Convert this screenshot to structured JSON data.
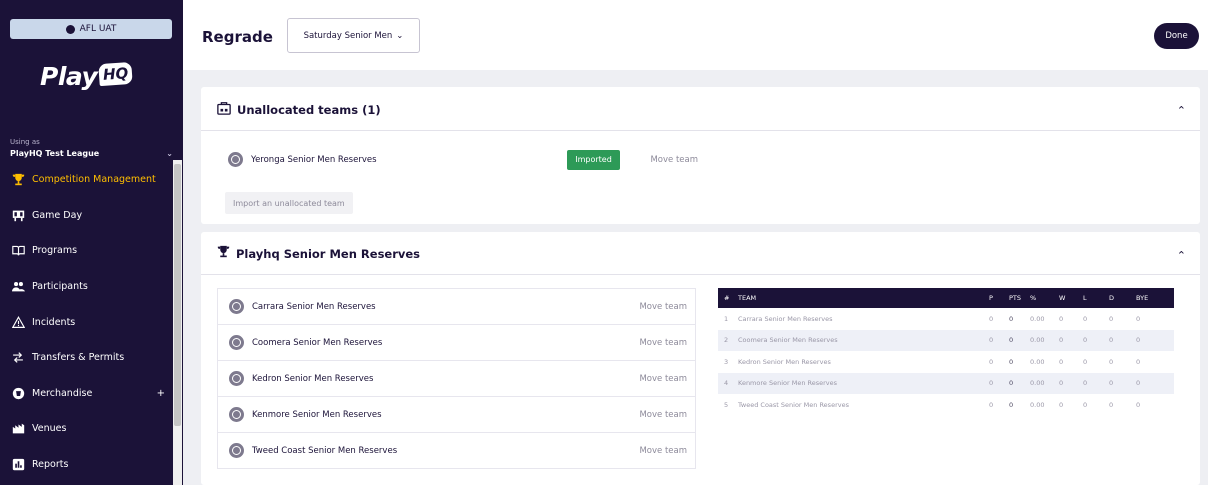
{
  "sidebar": {
    "env": "AFL UAT",
    "logo_play": "Play",
    "logo_hq": "HQ",
    "using_as": "Using as",
    "org_name": "PlayHQ Test League",
    "items": [
      {
        "label": "Competition Management",
        "icon": "trophy-icon",
        "active": true
      },
      {
        "label": "Game Day",
        "icon": "scoreboard-icon"
      },
      {
        "label": "Programs",
        "icon": "book-icon"
      },
      {
        "label": "Participants",
        "icon": "people-icon"
      },
      {
        "label": "Incidents",
        "icon": "warning-icon"
      },
      {
        "label": "Transfers & Permits",
        "icon": "transfer-icon"
      },
      {
        "label": "Merchandise",
        "icon": "merchandise-icon",
        "plus": "+"
      },
      {
        "label": "Venues",
        "icon": "venue-icon"
      },
      {
        "label": "Reports",
        "icon": "reports-icon"
      }
    ]
  },
  "header": {
    "title": "Regrade",
    "grade_select": "Saturday Senior Men",
    "done_label": "Done"
  },
  "unallocated": {
    "title": "Unallocated teams (1)",
    "team": "Yeronga Senior Men Reserves",
    "badge": "Imported",
    "move_label": "Move team",
    "import_label": "Import an unallocated team"
  },
  "grade": {
    "title": "Playhq Senior Men Reserves",
    "move_label": "Move team",
    "teams": [
      "Carrara Senior Men Reserves",
      "Coomera Senior Men Reserves",
      "Kedron Senior Men Reserves",
      "Kenmore Senior Men Reserves",
      "Tweed Coast Senior Men Reserves"
    ]
  },
  "ladder": {
    "columns": [
      "#",
      "TEAM",
      "P",
      "PTS",
      "%",
      "W",
      "L",
      "D",
      "BYE"
    ],
    "rows": [
      {
        "rank": "1",
        "team": "Carrara Senior Men Reserves",
        "p": "0",
        "pts": "0",
        "pct": "0.00",
        "w": "0",
        "l": "0",
        "d": "0",
        "bye": "0"
      },
      {
        "rank": "2",
        "team": "Coomera Senior Men Reserves",
        "p": "0",
        "pts": "0",
        "pct": "0.00",
        "w": "0",
        "l": "0",
        "d": "0",
        "bye": "0"
      },
      {
        "rank": "3",
        "team": "Kedron Senior Men Reserves",
        "p": "0",
        "pts": "0",
        "pct": "0.00",
        "w": "0",
        "l": "0",
        "d": "0",
        "bye": "0"
      },
      {
        "rank": "4",
        "team": "Kenmore Senior Men Reserves",
        "p": "0",
        "pts": "0",
        "pct": "0.00",
        "w": "0",
        "l": "0",
        "d": "0",
        "bye": "0"
      },
      {
        "rank": "5",
        "team": "Tweed Coast Senior Men Reserves",
        "p": "0",
        "pts": "0",
        "pct": "0.00",
        "w": "0",
        "l": "0",
        "d": "0",
        "bye": "0"
      }
    ]
  },
  "colors": {
    "sidebar_bg": "#1b1238",
    "active_nav": "#ffbe00",
    "imported_badge": "#2d9a57",
    "page_bg": "#eeeff3"
  }
}
